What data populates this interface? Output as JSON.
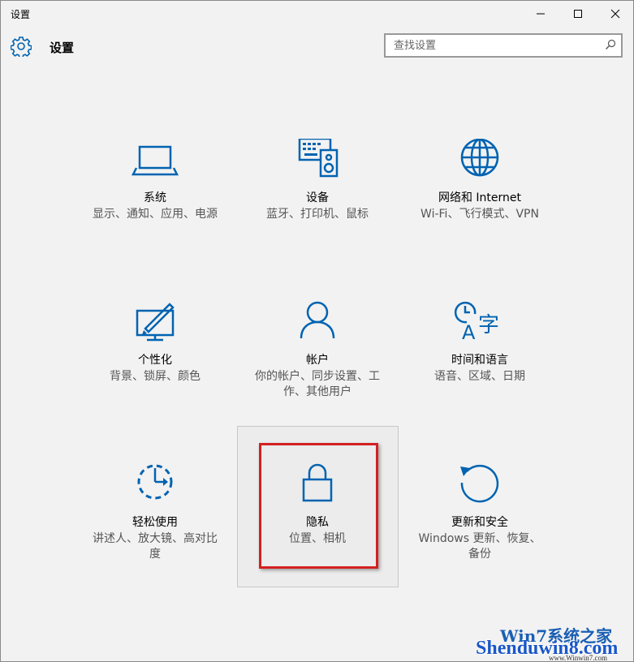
{
  "window": {
    "title": "设置",
    "controls": {
      "minimize": "minimize-icon",
      "maximize": "maximize-icon",
      "close": "close-icon"
    }
  },
  "header": {
    "title": "设置",
    "icon": "gear-icon"
  },
  "search": {
    "placeholder": "查找设置",
    "icon": "search-icon"
  },
  "accent_color": "#0063b1",
  "highlight_color": "#d42020",
  "tiles": [
    {
      "name": "系统",
      "desc": "显示、通知、应用、电源",
      "icon": "laptop-icon"
    },
    {
      "name": "设备",
      "desc": "蓝牙、打印机、鼠标",
      "icon": "devices-icon"
    },
    {
      "name": "网络和 Internet",
      "desc": "Wi-Fi、飞行模式、VPN",
      "icon": "globe-icon"
    },
    {
      "name": "个性化",
      "desc": "背景、锁屏、颜色",
      "icon": "personalization-icon"
    },
    {
      "name": "帐户",
      "desc": "你的帐户、同步设置、工作、其他用户",
      "icon": "person-icon"
    },
    {
      "name": "时间和语言",
      "desc": "语音、区域、日期",
      "icon": "time-language-icon"
    },
    {
      "name": "轻松使用",
      "desc": "讲述人、放大镜、高对比度",
      "icon": "ease-of-access-icon"
    },
    {
      "name": "隐私",
      "desc": "位置、相机",
      "icon": "lock-icon"
    },
    {
      "name": "更新和安全",
      "desc": "Windows 更新、恢复、备份",
      "icon": "update-icon"
    }
  ],
  "watermark": {
    "top": "Win7系统之家",
    "main": "Shenduwin8.com",
    "sub": "www.Winwin7.com"
  }
}
